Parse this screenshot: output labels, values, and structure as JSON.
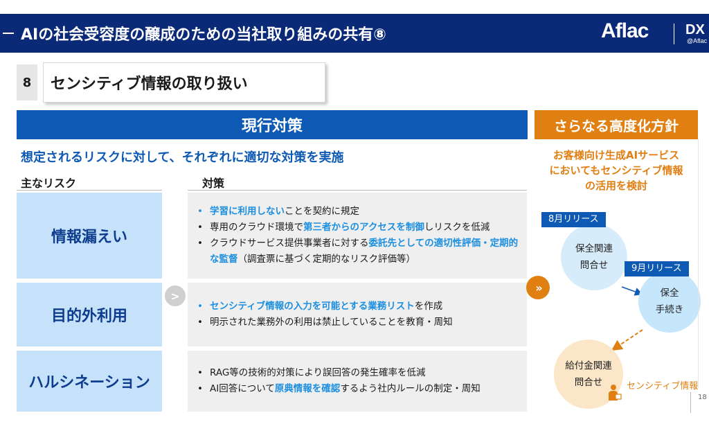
{
  "header": {
    "title": "AIの社会受容度の醸成のための当社取り組みの共有⑧",
    "logo": "Aflac",
    "dx": "DX",
    "dx_sub": "@Aflac"
  },
  "section": {
    "number": "8",
    "title": "センシティブ情報の取り扱い"
  },
  "banners": {
    "current": "現行対策",
    "future": "さらなる高度化方針"
  },
  "subtitle": "想定されるリスクに対して、それぞれに適切な対策を実施",
  "columns": {
    "risk": "主なリスク",
    "measure": "対策"
  },
  "connector": ">",
  "risks": [
    {
      "name": "情報漏えい",
      "measures": [
        {
          "bullet": "blue",
          "segments": [
            {
              "t": "学習に利用しない",
              "hl": true
            },
            {
              "t": "ことを契約に規定",
              "hl": false
            }
          ]
        },
        {
          "bullet": "black",
          "segments": [
            {
              "t": "専用のクラウド環境で",
              "hl": false
            },
            {
              "t": "第三者からのアクセスを制御",
              "hl": true
            },
            {
              "t": "しリスクを低減",
              "hl": false
            }
          ]
        },
        {
          "bullet": "black",
          "segments": [
            {
              "t": "クラウドサービス提供事業者に対する",
              "hl": false
            },
            {
              "t": "委託先としての適切性評価・定期的な監督",
              "hl": true
            },
            {
              "t": "（調査票に基づく定期的なリスク評価等）",
              "hl": false
            }
          ]
        }
      ]
    },
    {
      "name": "目的外利用",
      "measures": [
        {
          "bullet": "blue",
          "segments": [
            {
              "t": "センシティブ情報の入力を可能とする業務リスト",
              "hl": true
            },
            {
              "t": "を作成",
              "hl": false
            }
          ]
        },
        {
          "bullet": "black",
          "segments": [
            {
              "t": "明示された業務外の利用は禁止していることを教育・周知",
              "hl": false
            }
          ]
        }
      ]
    },
    {
      "name": "ハルシネーション",
      "measures": [
        {
          "bullet": "black",
          "segments": [
            {
              "t": "RAG等の技術的対策により誤回答の発生確率を低減",
              "hl": false
            }
          ]
        },
        {
          "bullet": "black",
          "segments": [
            {
              "t": "AI回答について",
              "hl": false
            },
            {
              "t": "原典情報を確認",
              "hl": true
            },
            {
              "t": "するよう社内ルールの制定・周知",
              "hl": false
            }
          ]
        }
      ]
    }
  ],
  "future": {
    "note_lines": [
      "お客様向け生成AIサービス",
      "においてもセンシティブ情報",
      "の活用を検討"
    ],
    "chevron": "»",
    "releases": [
      {
        "tag": "8月リリース",
        "lines": [
          "保全関連",
          "問合せ"
        ]
      },
      {
        "tag": "9月リリース",
        "lines": [
          "保全",
          "手続き"
        ]
      }
    ],
    "planned": {
      "lines": [
        "給付金関連",
        "問合せ"
      ]
    },
    "sensitive_label": "センシティブ情報"
  },
  "page_number": "18",
  "colors": {
    "header": "#0a2a78",
    "blue": "#0d59b3",
    "orange": "#e07f12",
    "highlight": "#1d8fe0",
    "risk_box": "#c6e2fb"
  }
}
